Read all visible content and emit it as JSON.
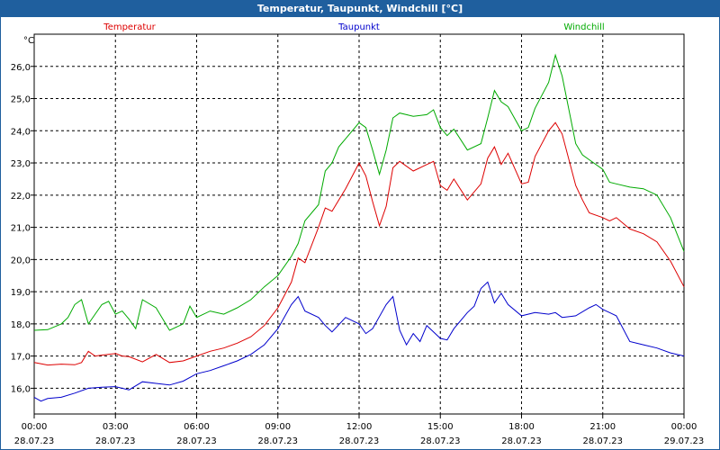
{
  "window": {
    "title": "Temperatur, Taupunkt, Windchill [°C]"
  },
  "chart_data": {
    "type": "line",
    "title": "Temperatur, Taupunkt, Windchill [°C]",
    "ylabel": "°C",
    "xlabel": "",
    "ylim": [
      15.2,
      27.0
    ],
    "xlim": [
      0,
      24
    ],
    "grid": true,
    "legend_placement": "top",
    "y_ticks": [
      16.0,
      17.0,
      18.0,
      19.0,
      20.0,
      21.0,
      22.0,
      23.0,
      24.0,
      25.0,
      26.0
    ],
    "y_tick_labels": [
      "16,0",
      "17,0",
      "18,0",
      "19,0",
      "20,0",
      "21,0",
      "22,0",
      "23,0",
      "24,0",
      "25,0",
      "26,0"
    ],
    "x_ticks": [
      0,
      3,
      6,
      9,
      12,
      15,
      18,
      21,
      24
    ],
    "x_tick_labels": [
      {
        "time": "00:00",
        "date": "28.07.23"
      },
      {
        "time": "03:00",
        "date": "28.07.23"
      },
      {
        "time": "06:00",
        "date": "28.07.23"
      },
      {
        "time": "09:00",
        "date": "28.07.23"
      },
      {
        "time": "12:00",
        "date": "28.07.23"
      },
      {
        "time": "15:00",
        "date": "28.07.23"
      },
      {
        "time": "18:00",
        "date": "28.07.23"
      },
      {
        "time": "21:00",
        "date": "28.07.23"
      },
      {
        "time": "00:00",
        "date": "29.07.23"
      }
    ],
    "series": [
      {
        "name": "Temperatur",
        "color": "#dd0000",
        "points": [
          [
            0,
            16.8
          ],
          [
            0.5,
            16.72
          ],
          [
            1,
            16.75
          ],
          [
            1.5,
            16.73
          ],
          [
            1.75,
            16.8
          ],
          [
            2,
            17.15
          ],
          [
            2.25,
            17.0
          ],
          [
            2.5,
            17.03
          ],
          [
            3,
            17.08
          ],
          [
            3.25,
            17.0
          ],
          [
            3.5,
            16.98
          ],
          [
            4,
            16.82
          ],
          [
            4.5,
            17.05
          ],
          [
            5,
            16.8
          ],
          [
            5.5,
            16.85
          ],
          [
            6,
            17.0
          ],
          [
            6.5,
            17.15
          ],
          [
            7,
            17.25
          ],
          [
            7.5,
            17.4
          ],
          [
            8,
            17.6
          ],
          [
            8.5,
            17.95
          ],
          [
            9,
            18.5
          ],
          [
            9.5,
            19.3
          ],
          [
            9.75,
            20.05
          ],
          [
            10,
            19.9
          ],
          [
            10.5,
            21.0
          ],
          [
            10.75,
            21.6
          ],
          [
            11,
            21.5
          ],
          [
            11.5,
            22.2
          ],
          [
            12,
            23.0
          ],
          [
            12.25,
            22.6
          ],
          [
            12.5,
            21.8
          ],
          [
            12.75,
            21.05
          ],
          [
            13,
            21.65
          ],
          [
            13.25,
            22.85
          ],
          [
            13.5,
            23.05
          ],
          [
            14,
            22.75
          ],
          [
            14.5,
            22.95
          ],
          [
            14.75,
            23.05
          ],
          [
            15,
            22.3
          ],
          [
            15.25,
            22.15
          ],
          [
            15.5,
            22.5
          ],
          [
            16,
            21.85
          ],
          [
            16.5,
            22.35
          ],
          [
            16.75,
            23.15
          ],
          [
            17,
            23.5
          ],
          [
            17.25,
            22.95
          ],
          [
            17.5,
            23.3
          ],
          [
            18,
            22.35
          ],
          [
            18.25,
            22.4
          ],
          [
            18.5,
            23.2
          ],
          [
            19,
            24.0
          ],
          [
            19.25,
            24.25
          ],
          [
            19.5,
            23.9
          ],
          [
            20,
            22.3
          ],
          [
            20.25,
            21.85
          ],
          [
            20.5,
            21.45
          ],
          [
            21,
            21.3
          ],
          [
            21.25,
            21.2
          ],
          [
            21.5,
            21.3
          ],
          [
            22,
            20.95
          ],
          [
            22.5,
            20.8
          ],
          [
            23,
            20.55
          ],
          [
            23.5,
            19.95
          ],
          [
            24,
            19.15
          ]
        ]
      },
      {
        "name": "Taupunkt",
        "color": "#0000cc",
        "points": [
          [
            0,
            15.72
          ],
          [
            0.25,
            15.6
          ],
          [
            0.5,
            15.68
          ],
          [
            1,
            15.72
          ],
          [
            1.5,
            15.85
          ],
          [
            2,
            16.0
          ],
          [
            2.5,
            16.03
          ],
          [
            3,
            16.05
          ],
          [
            3.5,
            15.95
          ],
          [
            4,
            16.2
          ],
          [
            4.5,
            16.15
          ],
          [
            5,
            16.1
          ],
          [
            5.5,
            16.22
          ],
          [
            6,
            16.45
          ],
          [
            6.5,
            16.55
          ],
          [
            7,
            16.7
          ],
          [
            7.5,
            16.85
          ],
          [
            8,
            17.05
          ],
          [
            8.5,
            17.35
          ],
          [
            9,
            17.85
          ],
          [
            9.5,
            18.6
          ],
          [
            9.75,
            18.85
          ],
          [
            10,
            18.4
          ],
          [
            10.5,
            18.2
          ],
          [
            10.75,
            17.95
          ],
          [
            11,
            17.75
          ],
          [
            11.5,
            18.2
          ],
          [
            12,
            18.0
          ],
          [
            12.25,
            17.7
          ],
          [
            12.5,
            17.85
          ],
          [
            13,
            18.6
          ],
          [
            13.25,
            18.85
          ],
          [
            13.5,
            17.8
          ],
          [
            13.75,
            17.35
          ],
          [
            14,
            17.7
          ],
          [
            14.25,
            17.45
          ],
          [
            14.5,
            17.95
          ],
          [
            15,
            17.55
          ],
          [
            15.25,
            17.5
          ],
          [
            15.5,
            17.85
          ],
          [
            16,
            18.35
          ],
          [
            16.25,
            18.55
          ],
          [
            16.5,
            19.1
          ],
          [
            16.75,
            19.3
          ],
          [
            17,
            18.65
          ],
          [
            17.25,
            18.95
          ],
          [
            17.5,
            18.6
          ],
          [
            18,
            18.25
          ],
          [
            18.5,
            18.35
          ],
          [
            19,
            18.3
          ],
          [
            19.25,
            18.35
          ],
          [
            19.5,
            18.2
          ],
          [
            20,
            18.25
          ],
          [
            20.5,
            18.5
          ],
          [
            20.75,
            18.6
          ],
          [
            21,
            18.45
          ],
          [
            21.25,
            18.35
          ],
          [
            21.5,
            18.25
          ],
          [
            22,
            17.45
          ],
          [
            22.5,
            17.35
          ],
          [
            23,
            17.25
          ],
          [
            23.5,
            17.1
          ],
          [
            24,
            17.0
          ]
        ]
      },
      {
        "name": "Windchill",
        "color": "#00aa00",
        "points": [
          [
            0,
            17.8
          ],
          [
            0.5,
            17.82
          ],
          [
            1,
            18.0
          ],
          [
            1.25,
            18.2
          ],
          [
            1.5,
            18.6
          ],
          [
            1.75,
            18.75
          ],
          [
            2,
            18.0
          ],
          [
            2.5,
            18.6
          ],
          [
            2.75,
            18.7
          ],
          [
            3,
            18.3
          ],
          [
            3.25,
            18.4
          ],
          [
            3.5,
            18.15
          ],
          [
            3.75,
            17.85
          ],
          [
            4,
            18.75
          ],
          [
            4.5,
            18.5
          ],
          [
            5,
            17.8
          ],
          [
            5.5,
            18.0
          ],
          [
            5.75,
            18.55
          ],
          [
            6,
            18.2
          ],
          [
            6.5,
            18.4
          ],
          [
            7,
            18.3
          ],
          [
            7.5,
            18.5
          ],
          [
            8,
            18.75
          ],
          [
            8.5,
            19.15
          ],
          [
            9,
            19.5
          ],
          [
            9.5,
            20.1
          ],
          [
            9.75,
            20.5
          ],
          [
            10,
            21.2
          ],
          [
            10.5,
            21.7
          ],
          [
            10.75,
            22.75
          ],
          [
            11,
            23.0
          ],
          [
            11.25,
            23.5
          ],
          [
            11.5,
            23.75
          ],
          [
            12,
            24.25
          ],
          [
            12.25,
            24.1
          ],
          [
            12.5,
            23.4
          ],
          [
            12.75,
            22.65
          ],
          [
            13,
            23.4
          ],
          [
            13.25,
            24.4
          ],
          [
            13.5,
            24.55
          ],
          [
            14,
            24.45
          ],
          [
            14.5,
            24.5
          ],
          [
            14.75,
            24.65
          ],
          [
            15,
            24.1
          ],
          [
            15.25,
            23.85
          ],
          [
            15.5,
            24.05
          ],
          [
            16,
            23.4
          ],
          [
            16.5,
            23.6
          ],
          [
            16.75,
            24.4
          ],
          [
            17,
            25.25
          ],
          [
            17.25,
            24.9
          ],
          [
            17.5,
            24.75
          ],
          [
            18,
            24.0
          ],
          [
            18.25,
            24.1
          ],
          [
            18.5,
            24.7
          ],
          [
            19,
            25.5
          ],
          [
            19.25,
            26.35
          ],
          [
            19.5,
            25.7
          ],
          [
            20,
            23.6
          ],
          [
            20.25,
            23.25
          ],
          [
            20.5,
            23.1
          ],
          [
            21,
            22.8
          ],
          [
            21.25,
            22.4
          ],
          [
            21.5,
            22.35
          ],
          [
            22,
            22.25
          ],
          [
            22.5,
            22.2
          ],
          [
            23,
            22.0
          ],
          [
            23.5,
            21.3
          ],
          [
            24,
            20.25
          ]
        ]
      }
    ]
  }
}
